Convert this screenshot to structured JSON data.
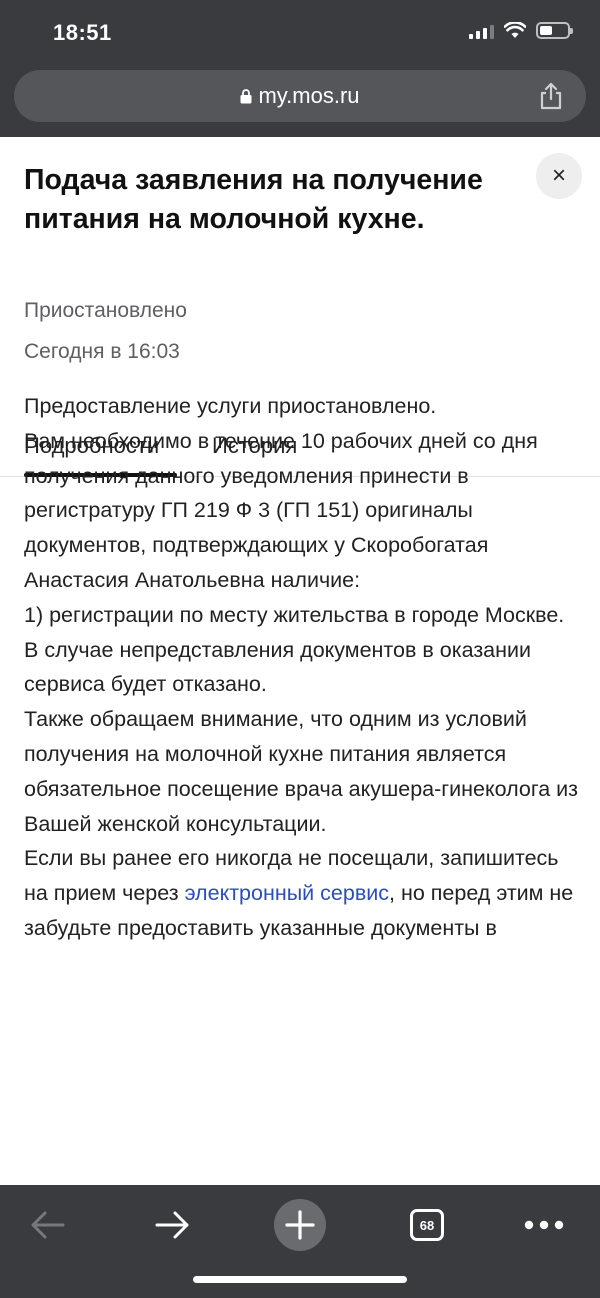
{
  "status_bar": {
    "time": "18:51"
  },
  "browser": {
    "url": "my.mos.ru",
    "tabs_count": "68"
  },
  "page": {
    "title": "Подача заявления на получение питания на молочной кухне.",
    "status": "Приостановлено",
    "date": "Сегодня в 16:03",
    "close_label": "×",
    "tabs": [
      {
        "label": "Подробности",
        "active": true
      },
      {
        "label": "История",
        "active": false
      }
    ],
    "details": {
      "line1": "Предоставление услуги приостановлено.",
      "line2": "Вам необходимо в течение 10 рабочих дней со дня получения данного уведомления принести в регистратуру ГП 219 Ф 3 (ГП 151) оригиналы документов, подтверждающих у Скоробогатая Анастасия Анатольевна наличие:",
      "line3": "1) регистрации по месту жительства в городе Москве.",
      "line4": "В случае непредставления документов в оказании сервиса будет отказано.",
      "line5": "Также обращаем внимание, что одним из условий получения на молочной кухне питания является обязательное посещение врача акушера-гинеколога из Вашей женской консультации.",
      "line6_before": "Если вы ранее его никогда не посещали, запишитесь на прием через ",
      "line6_link": "электронный сервис",
      "line6_after": ", но перед этим не забудьте предоставить указанные документы в"
    }
  },
  "colors": {
    "chrome_bg": "#3a3b3e",
    "link": "#2a4fb7"
  }
}
